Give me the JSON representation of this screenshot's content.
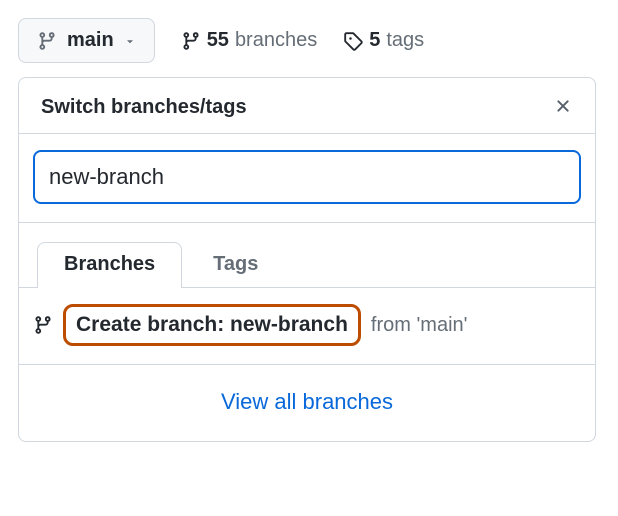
{
  "top": {
    "branch_button_label": "main",
    "branches_count": "55",
    "branches_label": "branches",
    "tags_count": "5",
    "tags_label": "tags"
  },
  "popover": {
    "title": "Switch branches/tags",
    "search_value": "new-branch",
    "tabs": {
      "branches": "Branches",
      "tags": "Tags"
    },
    "create_label": "Create branch: new-branch",
    "create_from": "from 'main'",
    "view_all": "View all branches"
  }
}
